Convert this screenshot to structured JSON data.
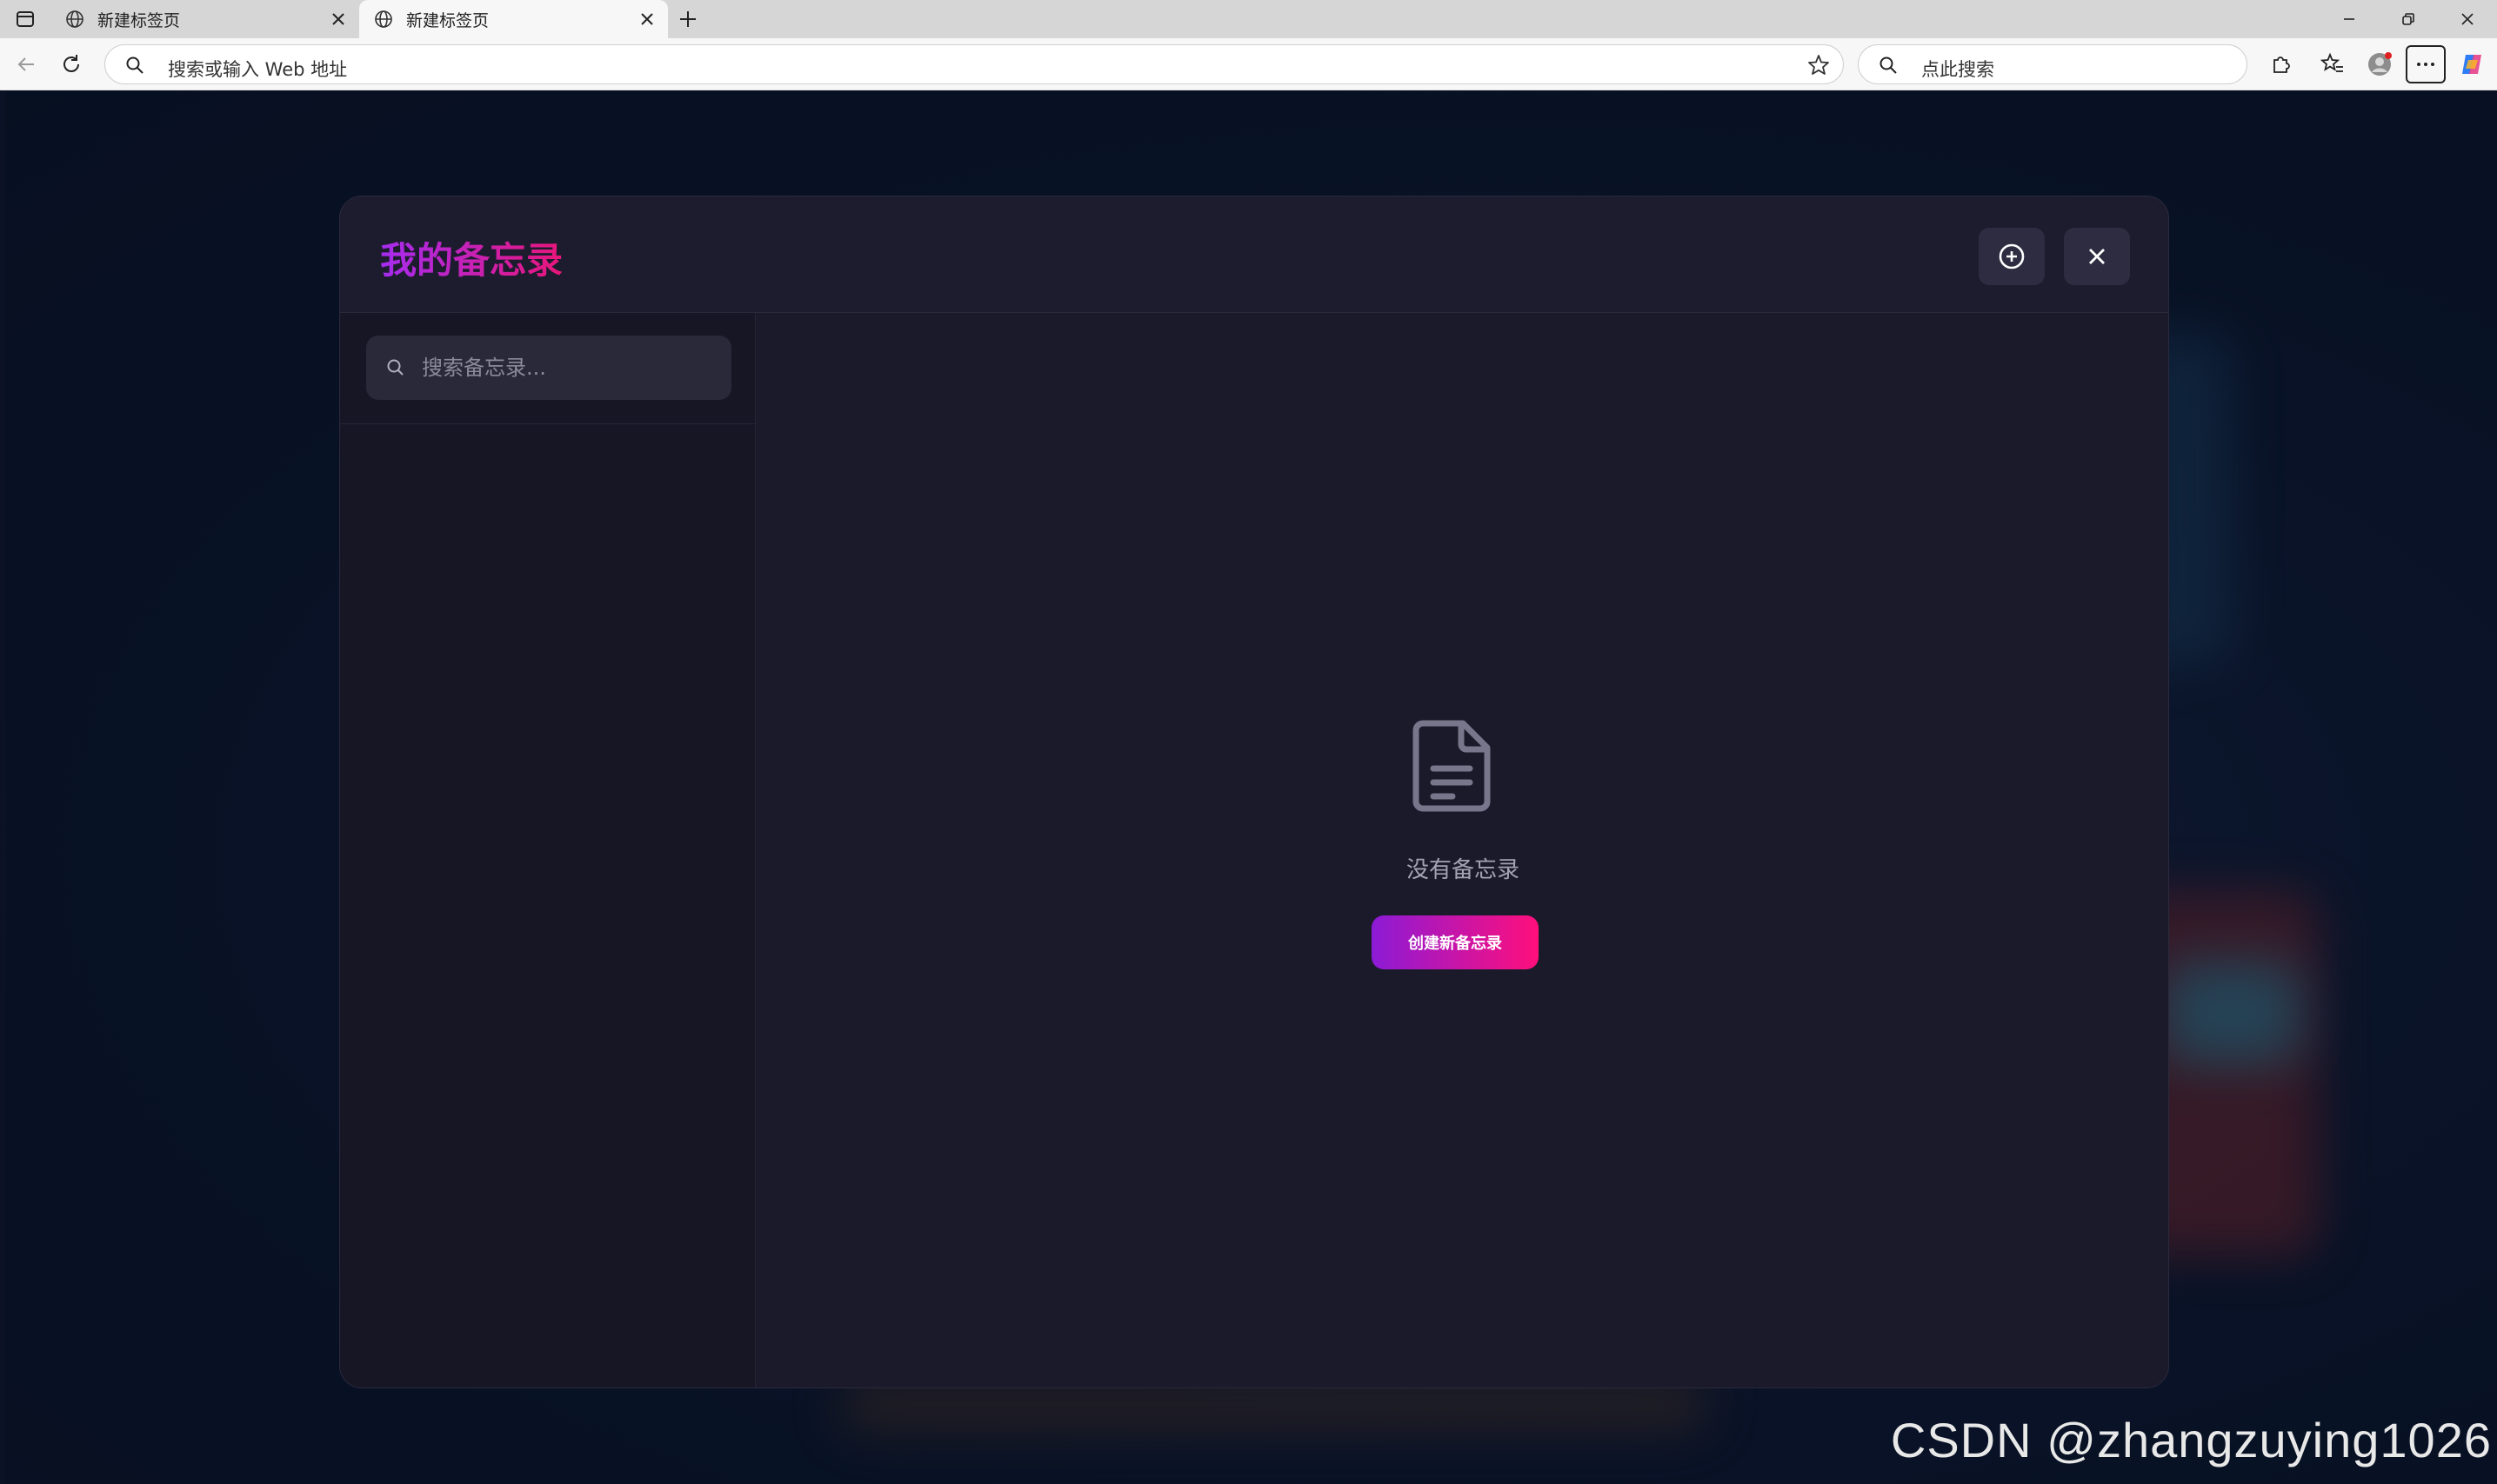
{
  "browser": {
    "tabs": [
      {
        "title": "新建标签页",
        "active": false
      },
      {
        "title": "新建标签页",
        "active": true
      }
    ],
    "address_placeholder": "搜索或输入 Web 地址",
    "search_placeholder": "点此搜索"
  },
  "modal": {
    "title": "我的备忘录",
    "search_placeholder": "搜索备忘录...",
    "empty_text": "没有备忘录",
    "create_button_label": "创建新备忘录"
  },
  "watermark": "CSDN @zhangzuying1026",
  "colors": {
    "accent_start": "#a52cf0",
    "accent_end": "#e9167a",
    "page_bg": "#0b1226",
    "modal_bg": "#1b1a2b"
  }
}
